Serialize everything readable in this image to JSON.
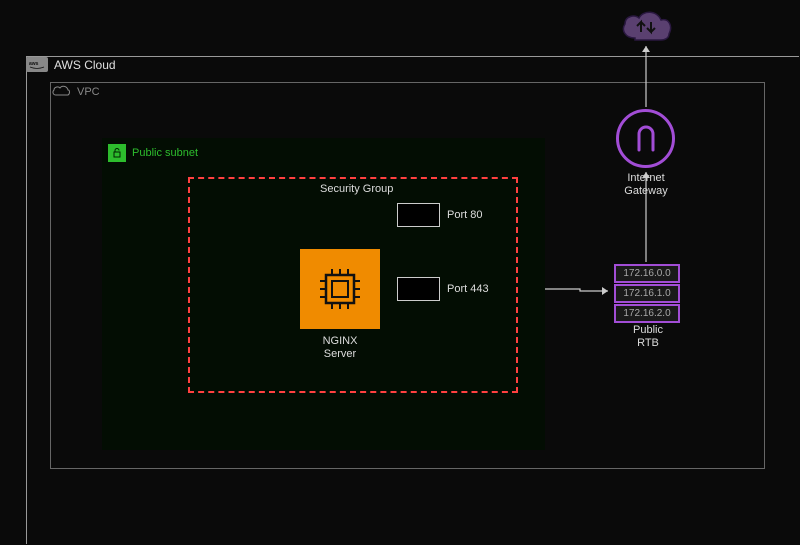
{
  "aws_cloud_label": "AWS Cloud",
  "vpc_label": "VPC",
  "subnet_label": "Public subnet",
  "security_group_label": "Security Group",
  "ec2_label_line1": "NGINX",
  "ec2_label_line2": "Server",
  "port80_label": "Port 80",
  "port443_label": "Port 443",
  "rtb": {
    "rows": [
      "172.16.0.0",
      "172.16.1.0",
      "172.16.2.0"
    ],
    "label_line1": "Public",
    "label_line2": "RTB"
  },
  "igw_label_line1": "Internet",
  "igw_label_line2": "Gateway"
}
